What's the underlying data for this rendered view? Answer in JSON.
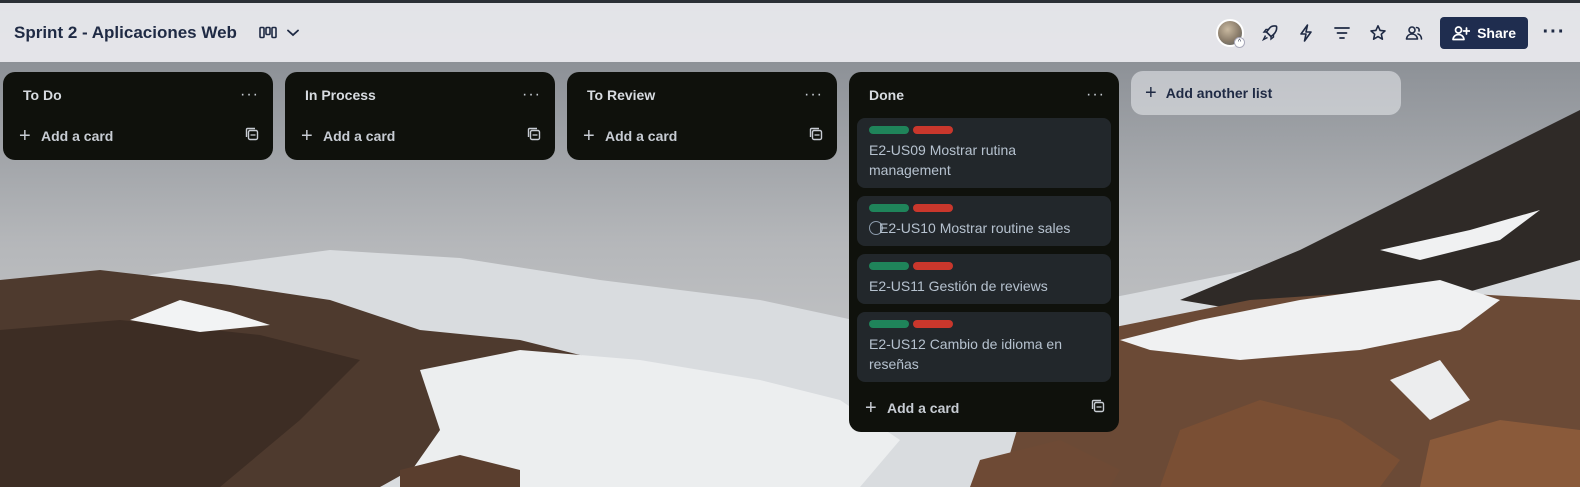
{
  "board": {
    "title": "Sprint 2 - Aplicaciones Web",
    "share_label": "Share",
    "more_label": "···"
  },
  "colors": {
    "label_green": "#1f845a",
    "label_red": "#c9372c",
    "list_bg": "#0f110c",
    "card_bg": "#22272b",
    "share_bg": "#1f2d4f"
  },
  "lists": [
    {
      "title": "To Do",
      "menu": "···",
      "add_card": "Add a card",
      "cards": []
    },
    {
      "title": "In Process",
      "menu": "···",
      "add_card": "Add a card",
      "cards": []
    },
    {
      "title": "To Review",
      "menu": "···",
      "add_card": "Add a card",
      "cards": []
    },
    {
      "title": "Done",
      "menu": "···",
      "add_card": "Add a card",
      "cards": [
        {
          "title": "E2-US09 Mostrar rutina management",
          "labels": [
            "green",
            "red"
          ]
        },
        {
          "title": "E2-US10 Mostrar routine sales",
          "labels": [
            "green",
            "red"
          ]
        },
        {
          "title": "E2-US11 Gestión de reviews",
          "labels": [
            "green",
            "red"
          ]
        },
        {
          "title": "E2-US12 Cambio de idioma en reseñas",
          "labels": [
            "green",
            "red"
          ]
        }
      ]
    }
  ],
  "add_list_label": "Add another list",
  "icons": {
    "view": "board-view-icon",
    "avatar": "user-avatar",
    "powerups": "rocket-icon",
    "automation": "lightning-icon",
    "filter": "filter-icon",
    "star": "star-icon",
    "visibility": "team-visibility-icon",
    "share": "add-user-icon"
  }
}
